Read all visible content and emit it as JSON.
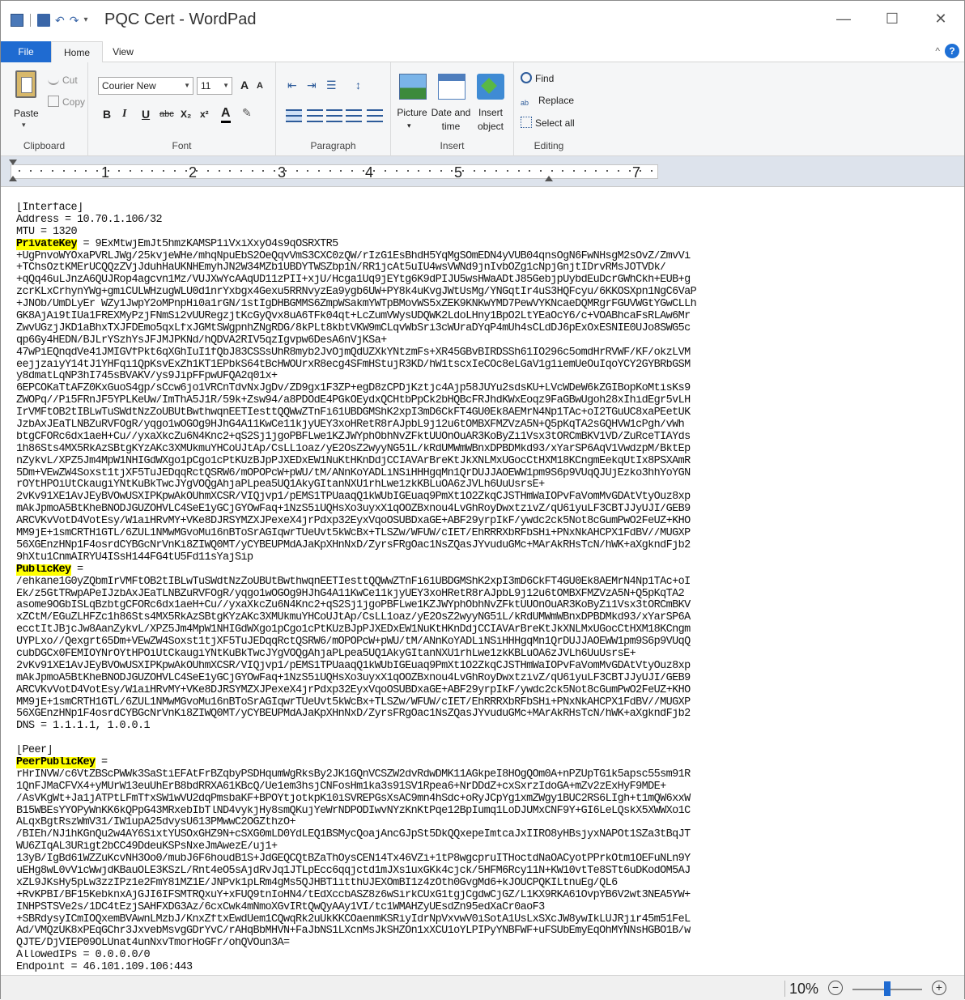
{
  "window": {
    "title": "PQC Cert - WordPad",
    "minimize_glyph": "—",
    "maximize_glyph": "☐",
    "close_glyph": "✕"
  },
  "tabs": {
    "file": "File",
    "home": "Home",
    "view": "View",
    "help": "?",
    "collapse": "^"
  },
  "ribbon": {
    "clipboard": {
      "label": "Clipboard",
      "paste": "Paste",
      "cut": "Cut",
      "copy": "Copy"
    },
    "font": {
      "label": "Font",
      "family": "Courier New",
      "size": "11",
      "grow": "A",
      "shrink": "A",
      "bold": "B",
      "italic": "I",
      "underline": "U",
      "strike": "abc",
      "subscript": "X₂",
      "superscript": "x²",
      "color": "A"
    },
    "paragraph": {
      "label": "Paragraph"
    },
    "insert": {
      "label": "Insert",
      "picture": "Picture",
      "date_time_line1": "Date and",
      "date_time_line2": "time",
      "object_line1": "Insert",
      "object_line2": "object"
    },
    "editing": {
      "label": "Editing",
      "find": "Find",
      "replace": "Replace",
      "select_all": "Select all"
    }
  },
  "ruler": {
    "numbers": [
      "1",
      "2",
      "3",
      "4",
      "5",
      "7"
    ]
  },
  "document": {
    "lines": [
      "[Interface]",
      "Address = 10.70.1.106/32",
      "MTU = 1320",
      "§PrivateKey§ = 9ExMtwjEmJt5hmzKAMSP1iVxiXxyO4s9qOSRXTR5",
      "+UgPnvoWYOxaPVRLJWg/25kvjeWHe/mhqNpuEbS2OeQqvVmS3CXC0zQW/rIzG1EsBhdH5YqMgSOmEDN4yVUB04qnsOgN6FwNHsgM2sOvZ/ZmvVi",
      "+TChsOztKMErUCQQzZVjJduhHaUKNHEmyhJN2W34MZb1UBDYTWSZbp1N/RR1jcAt5uIU4wsVWNd9jnIvbOZg1cNpjGnjtIDrvRMsJOTVDk/",
      "+qQq46uLJnzA6QUJRop4agcvn1Mz/VUJXwYcAAqUD11zPII+xjU/Hcga1Uq9jEYtg6K9dPIJU5wsHWaADtJ85GebjpUybdEuDcrGWhCkh+EUB+g",
      "zcrKLxCrhynYWg+gmiCULWHzugWLU0d1nrYxbgx4Gexu5RRNvyzEa9ygb6UW+PY8k4uKvgJWtUsMg/YNGqtIr4uS3HQFcyu/6KKOSXpn1NgC6VaP",
      "+JNOb/UmDLyEr WZy1JwpY2oMPnpHi0a1rGN/1stIgDHBGMMS6ZmpWSakmYWTpBMovWS5xZEK9KNKwYMD7PewVYKNcaeDQMRgrFGUVWGtYGwCLLh",
      "GK8AjAi9tIUa1FREXMyPzjFNmSi2vUURegzjtKcGyQvx8uA6TFk04qt+LcZumVWysUDQWK2LdoLHny1BpO2LtYEaOcY6/c+VOABhcaFsRLAw6Mr",
      "ZwvUGzjJKD1aBhxTXJFDEmo5qxLfxJGMtSWgpnhZNgRDG/8kPLt8kbtVKW9mCLqvWbSri3cWUraDYqP4mUh4sCLdDJ6pExOxESNIE0UJo8SWG5c",
      "qp6Gy4HEDN/BJLrYSzhYsJFJMJPKNd/hQDVA2RIV5qzIgvpw6DesA6nVjKSa+",
      "47wPiEQnqdVe41JMIGVfPkt6qXGhIuI1fQbJ83CSSsUhR8myb2JvOjmQdUZXkYNtzmFs+XR45GBvBIRDSSh61IO296c5omdHrRVWF/KF/okzLVM",
      "eejjzaiyY14tJ1YHFqi1QpKsvExZh1KT1EPbkS64tBcHWOUrxR8ecg4SFmHStujR3KD/hW1tscxIeCOc8eLGaV1g1iemUeOuIqoYCY2GYBRbGSM",
      "y8dmatLqNP3hI745sBVAKV/ys9JipFFpwUFQA2q01x+",
      "6EPCOKaTtAFZ0KxGuoS4gp/sCcw6jo1VRCnTdvNxJgDv/ZD9gx1F3ZP+egD8zCPDjKztjc4Ajp58JUYu2sdsKU+LVcWDeW6kZGIBopKoMtisKs9",
      "ZWOPq//Pi5FRnJF5YPLKeUw/ImThA5J1R/59k+Zsw94/a8PDOdE4PGkOEydxQCHtbPpCk2bHQBcFRJhdKWxEoqz9FaGBwUgoh28xIhidEgr5vLH",
      "IrVMFtOB2tIBLwTuSWdtNzZoUBUtBwthwqnEETIesttQQWwZTnFi61UBDGMShK2xpI3mD6CkFT4GU0Ek8AEMrN4Np1TAc+oI2TGuUC8xaPEetUK",
      "JzbAxJEaTLNBZuRVFOgR/yqgo1wOGOg9HJhG4A11KwCe11kjyUEY3xoHRetR8rAJpbL9j12u6tOMBXFMZVzA5N+Q5pKqTA2sGQHVW1cPgh/vWh",
      "btgCFORc6dx1aeH+Cu//yxaXkcZu6N4Knc2+qS2Sj1jgoPBFLwe1KZJWYphObhNvZFktUUOnOuAR3KoByZi1Vsx3tORCmBKV1VD/ZuRceTIAYds",
      "1h86Sts4MX5RkAzSBtgKYzAKc3XMUkmuYHCoUJtAp/CsLL1oaz/yE2OsZ2wyyNG51L/kRdUMWmWBnxDPBDMkd93/xYarSP6AqV1VwdzpM/BktEp",
      "nZykvL/XPZ5Jm4MpW1NHIGdWXgo1pCgo1cPtKUzBJpPJXEDxEW1NuKtHKnDdjCCIAVArBreKtJkXNLMxUGocCtHXM18KCngmEekqUtIx8PSXAmR",
      "5Dm+VEwZW4Soxst1tjXF5TuJEDqqRctQSRW6/mOPOPcW+pWU/tM/ANnKoYADLiNSiHHHgqMn1QrDUJJAOEWW1pm9S6p9VUqQJUjEzko3hhYoYGN",
      "rOYtHPOiUtCkaugiYNtKuBkTwcJYgVOQgAhjaPLpea5UQ1AkyGItanNXU1rhLwe1zkKBLuOA6zJVLh6UuUsrsE+",
      "2vKv91XE1AvJEyBVOwUSXIPKpwAkOUhmXCSR/VIQjvp1/pEMS1TPUaaqQ1kWUbIGEuaq9PmXt1O2ZkqCJSTHmWaIOPvFaVomMvGDAtVtyOuz8xp",
      "mAkJpmoA5BtKheBNODJGUZOHVLC4SeE1yGCjGYOwFaq+1NzS5iUQHsXo3uyxX1qOOZBxnou4LvGhRoyDwxtzivZ/qU61yuLF3CBTJJyUJI/GEB9",
      "ARCVKvVotD4VotEsy/W1aiHRvMY+VKe8DJRSYMZXJPexeX4jrPdxp32EyxVqoOSUBDxaGE+ABF29yrpIkF/ywdc2ck5Not8cGumPwO2FeUZ+KHO",
      "MM9jE+1smCRTH1GTL/6ZUL1NMwMGvoMu16nBToSrAGIqwrTUeUvt5kWcBx+TLSZw/WFUW/cIET/EhRRRXbRFbSHi+PNxNkAHCPX1FdBV//MUGXP",
      "56XGEnzHNp1F4osrdCYBGcNrVnKi8ZIWQ0MT/yCYBEUPMdAJaKpXHnNxD/ZyrsFRgOac1NsZQasJYvuduGMc+MArAkRHsTcN/hWK+aXgkndFjb2",
      "9hXtu1CnmAIRYU4ISsH144FG4tU5Fd11sYajSip",
      "§PublicKey§ =",
      "/ehkane1G0yZQbmIrVMFtOB2tIBLwTuSWdtNzZoUBUtBwthwqnEETIesttQQWwZTnFi61UBDGMShK2xpI3mD6CkFT4GU0Ek8AEMrN4Np1TAc+oI",
      "Ek/z5GtTRwpAPeIJzbAxJEaTLNBZuRVFOgR/yqgo1wOGOg9HJhG4A11KwCe11kjyUEY3xoHRetR8rAJpbL9j12u6tOMBXFMZVzA5N+Q5pKqTA2",
      "asome9OGbISLqBzbtgCFORc6dx1aeH+Cu//yxaXkcZu6N4Knc2+qS2Sj1jgoPBFLwe1KZJWYphObhNvZFktUUOnOuAR3KoByZi1Vsx3tORCmBKV",
      "xZCtM/EGuZLHFZc1h86Sts4MX5RkAzSBtgKYzAKc3XMUkmuYHCoUJtAp/CsLL1oaz/yE2OsZ2wyyNG51L/kRdUMWmWBnxDPBDMkd93/xYarSP6A",
      "ecctItJBjcJw8AanZykvL/XPZ5Jm4MpW1NHIGdWXgo1pCgo1cPtKUzBJpPJXEDxEW1NuKtHKnDdjCCIAVArBreKtJkXNLMxUGocCtHXM18KCngm",
      "UYPLxo//Qexgrt65Dm+VEwZW4Soxst1tjXF5TuJEDqqRctQSRW6/mOPOPcW+pWU/tM/ANnKoYADLiNSiHHHgqMn1QrDUJJAOEWW1pm9S6p9VUqQ",
      "cubDGCx0FEMIOYNrOYtHPOiUtCkaugiYNtKuBkTwcJYgVOQgAhjaPLpea5UQ1AkyGItanNXU1rhLwe1zkKBLuOA6zJVLh6UuUsrsE+",
      "2vKv91XE1AvJEyBVOwUSXIPKpwAkOUhmXCSR/VIQjvp1/pEMS1TPUaaqQ1kWUbIGEuaq9PmXt1O2ZkqCJSTHmWaIOPvFaVomMvGDAtVtyOuz8xp",
      "mAkJpmoA5BtKheBNODJGUZOHVLC4SeE1yGCjGYOwFaq+1NzS5iUQHsXo3uyxX1qOOZBxnou4LvGhRoyDwxtzivZ/qU61yuLF3CBTJJyUJI/GEB9",
      "ARCVKvVotD4VotEsy/W1aiHRvMY+VKe8DJRSYMZXJPexeX4jrPdxp32EyxVqoOSUBDxaGE+ABF29yrpIkF/ywdc2ck5Not8cGumPwO2FeUZ+KHO",
      "MM9jE+1smCRTH1GTL/6ZUL1NMwMGvoMu16nBToSrAGIqwrTUeUvt5kWcBx+TLSZw/WFUW/cIET/EhRRRXbRFbSHi+PNxNkAHCPX1FdBV//MUGXP",
      "56XGEnzHNp1F4osrdCYBGcNrVnKi8ZIWQ0MT/yCYBEUPMdAJaKpXHnNxD/ZyrsFRgOac1NsZQasJYvuduGMc+MArAkRHsTcN/hWK+aXgkndFjb2",
      "DNS = 1.1.1.1, 1.0.0.1",
      "",
      "[Peer]",
      "§PeerPublicKey§ =",
      "rHrINVW/c6VtZBScPWWk3SaStiEFAtFrBZqbyPSDHqumWgRksBy2JK1GQnVCSZW2dvRdwDMK11AGkpeI8HOgQOm0A+nPZUpTG1k5apsc55sm91R",
      "1QnFJMaCFVX4+yMUrW13euUhErB8bdRRXA61KBcQ/Ue1em3hsjCNFosHm1ka3s91SV1Rpea6+NrDDdZ+cxSxrzIdoGA+mZv2zExHyF9MDE+",
      "/AsVKgWt+Ja1jATPtLFmTfxSW1wVU2dqPmsbaKF+BPOYtjotkpK10iSVREPGsXsAC9mn4hSdc+oRyJCpYg1xmZWgy1BUC2RS6LIgh+t1mQW6xxW",
      "B15WBEsYYOPyWnKK6kQPpG43MRxebIbTlND4vykjHy8smQKujYeWrNDPODIwvNYzKnKtPqe12BpIumq1LoDJUMxCNF9Y+GI6LeLQskX5XWWXo1C",
      "ALqxBgtRszWmV31/IW1upA25dvysU613PMwwC2OGZthzO+",
      "/BIEh/NJ1hKGnQu2w4AY6SixtYUSOxGHZ9N+cSXG0mLD0YdLEQ1BSMycQoajAncGJpSt5DkQQxepeImtcaJxIIRO8yHBsjyxNAPOt1SZa3tBqJT",
      "WU6ZIqAL3URigt2bCC49DdeuKSPsNxeJmAwezE/uj1+",
      "13yB/IgBd61WZZuKcvNH3Oo0/mubJ6F6houdB1S+JdGEQCQtBZaThOysCEN14Tx46VZi+1tP8wgcpruITHoctdNaOACyotPPrkOtm1OEFuNLn9Y",
      "uEHg8wL0vVicWwjdKBauOLE3KSzL/Rnt4eO5sAjdRvJq1JTLpEcc6qqjctd1mJXs1uxGKk4cjck/5HFM6Rcy11N+KW10vtTe8STt6uDKodOM5AJ",
      "xZL9JKsHy5pLw3zzIPz1e2FmY81MZ1E/JNPvk1pLRm4gMs5QJHBT1itthUJEXOmBI1z4zOth0GvgMd6+kJOUCPQKILtnuEg/QL6",
      "+RvKPBI/BF15KebknxAjGJI6IFSMTRQxuY+xFUQ9tnIoHN4/tEdXccbASZ8z6wSirkCUxG1tgjCgdwCjGZ/L1KX9RKA61OvpYB6V2wt3NEA5YW+",
      "INHPSTSVe2s/1DC4tEzjSAHFXDG3Az/6cxCwk4mNmoXGvIRtQwQyAAy1VI/tc1WMAHZyUEsdZn95edXaCr0aoF3",
      "+SBRdysyICmIOQxemBVAwnLMzbJ/KnxZftxEwdUem1CQwqRk2uUkKKCOaenmKSRiyIdrNpVxvwV0iSotA1UsLxSXcJW8ywIkLUJRjir45m51FeL",
      "Ad/VMQzUK8xPEqGChr3JxvebMsvgGDrYvC/rAHqBbMHVN+FaJbNS1LXcnMsJkSHZOn1xXCU1oYLPIPyYNBFWF+uFSUbEmyEqOhMYNNsHGBO1B/w",
      "QJTE/DjVIEP09OLUnat4unNxvTmorHoGFr/ohQVOun3A=",
      "AllowedIPs = 0.0.0.0/0",
      "Endpoint = 46.101.109.106:443"
    ]
  },
  "status": {
    "zoom": "10%",
    "zoom_out": "−",
    "zoom_in": "+",
    "zoom_level": 0.5
  }
}
